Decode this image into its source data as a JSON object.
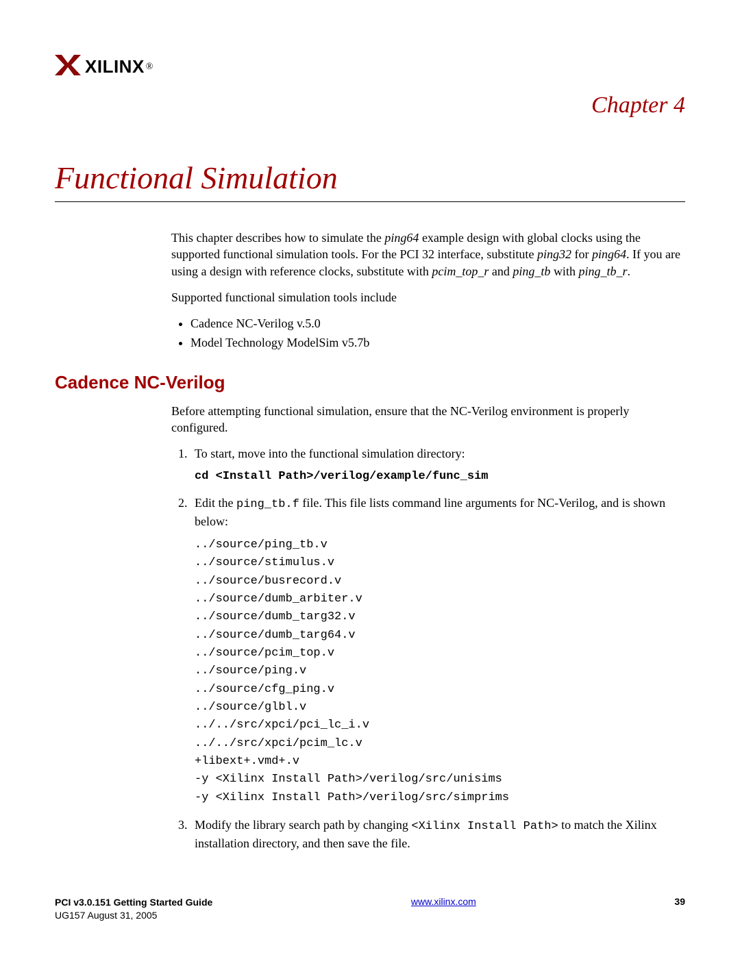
{
  "logo_text": "XILINX",
  "chapter_label": "Chapter 4",
  "chapter_title": "Functional Simulation",
  "intro_html": "This chapter describes how to simulate the <em>ping64</em> example design with global clocks using the supported functional simulation tools. For the PCI 32 interface, substitute <em>ping32</em> for <em>ping64</em>. If you are using a design with reference clocks, substitute with <em>pcim_top_r</em> and <em>ping_tb</em> with <em>ping_tb_r</em>.",
  "supported_label": "Supported functional simulation tools include",
  "tools": [
    "Cadence NC-Verilog v.5.0",
    "Model Technology ModelSim v5.7b"
  ],
  "section_heading": "Cadence NC-Verilog",
  "section_intro": "Before attempting functional simulation, ensure that the NC-Verilog environment is properly configured.",
  "step1_text": "To start, move into the functional simulation directory:",
  "step1_cmd": "cd <Install Path>/verilog/example/func_sim",
  "step2_html": "Edit the <span class=\"mono\">ping_tb.f</span> file. This file lists command line arguments for NC-Verilog, and is shown below:",
  "code_lines": [
    "../source/ping_tb.v",
    "../source/stimulus.v",
    "../source/busrecord.v",
    "../source/dumb_arbiter.v",
    "../source/dumb_targ32.v",
    "../source/dumb_targ64.v",
    "../source/pcim_top.v",
    "../source/ping.v",
    "../source/cfg_ping.v",
    "../source/glbl.v",
    "../../src/xpci/pci_lc_i.v",
    "../../src/xpci/pcim_lc.v",
    "+libext+.vmd+.v",
    "-y <Xilinx Install Path>/verilog/src/unisims",
    "-y <Xilinx Install Path>/verilog/src/simprims"
  ],
  "step3_html": "Modify the library search path by changing <span class=\"mono\">&lt;Xilinx Install Path&gt;</span> to match the Xilinx installation directory, and then save the file.",
  "footer": {
    "guide": "PCI v3.0.151 Getting Started Guide",
    "docref": "UG157 August 31, 2005",
    "url": "www.xilinx.com",
    "page": "39"
  }
}
